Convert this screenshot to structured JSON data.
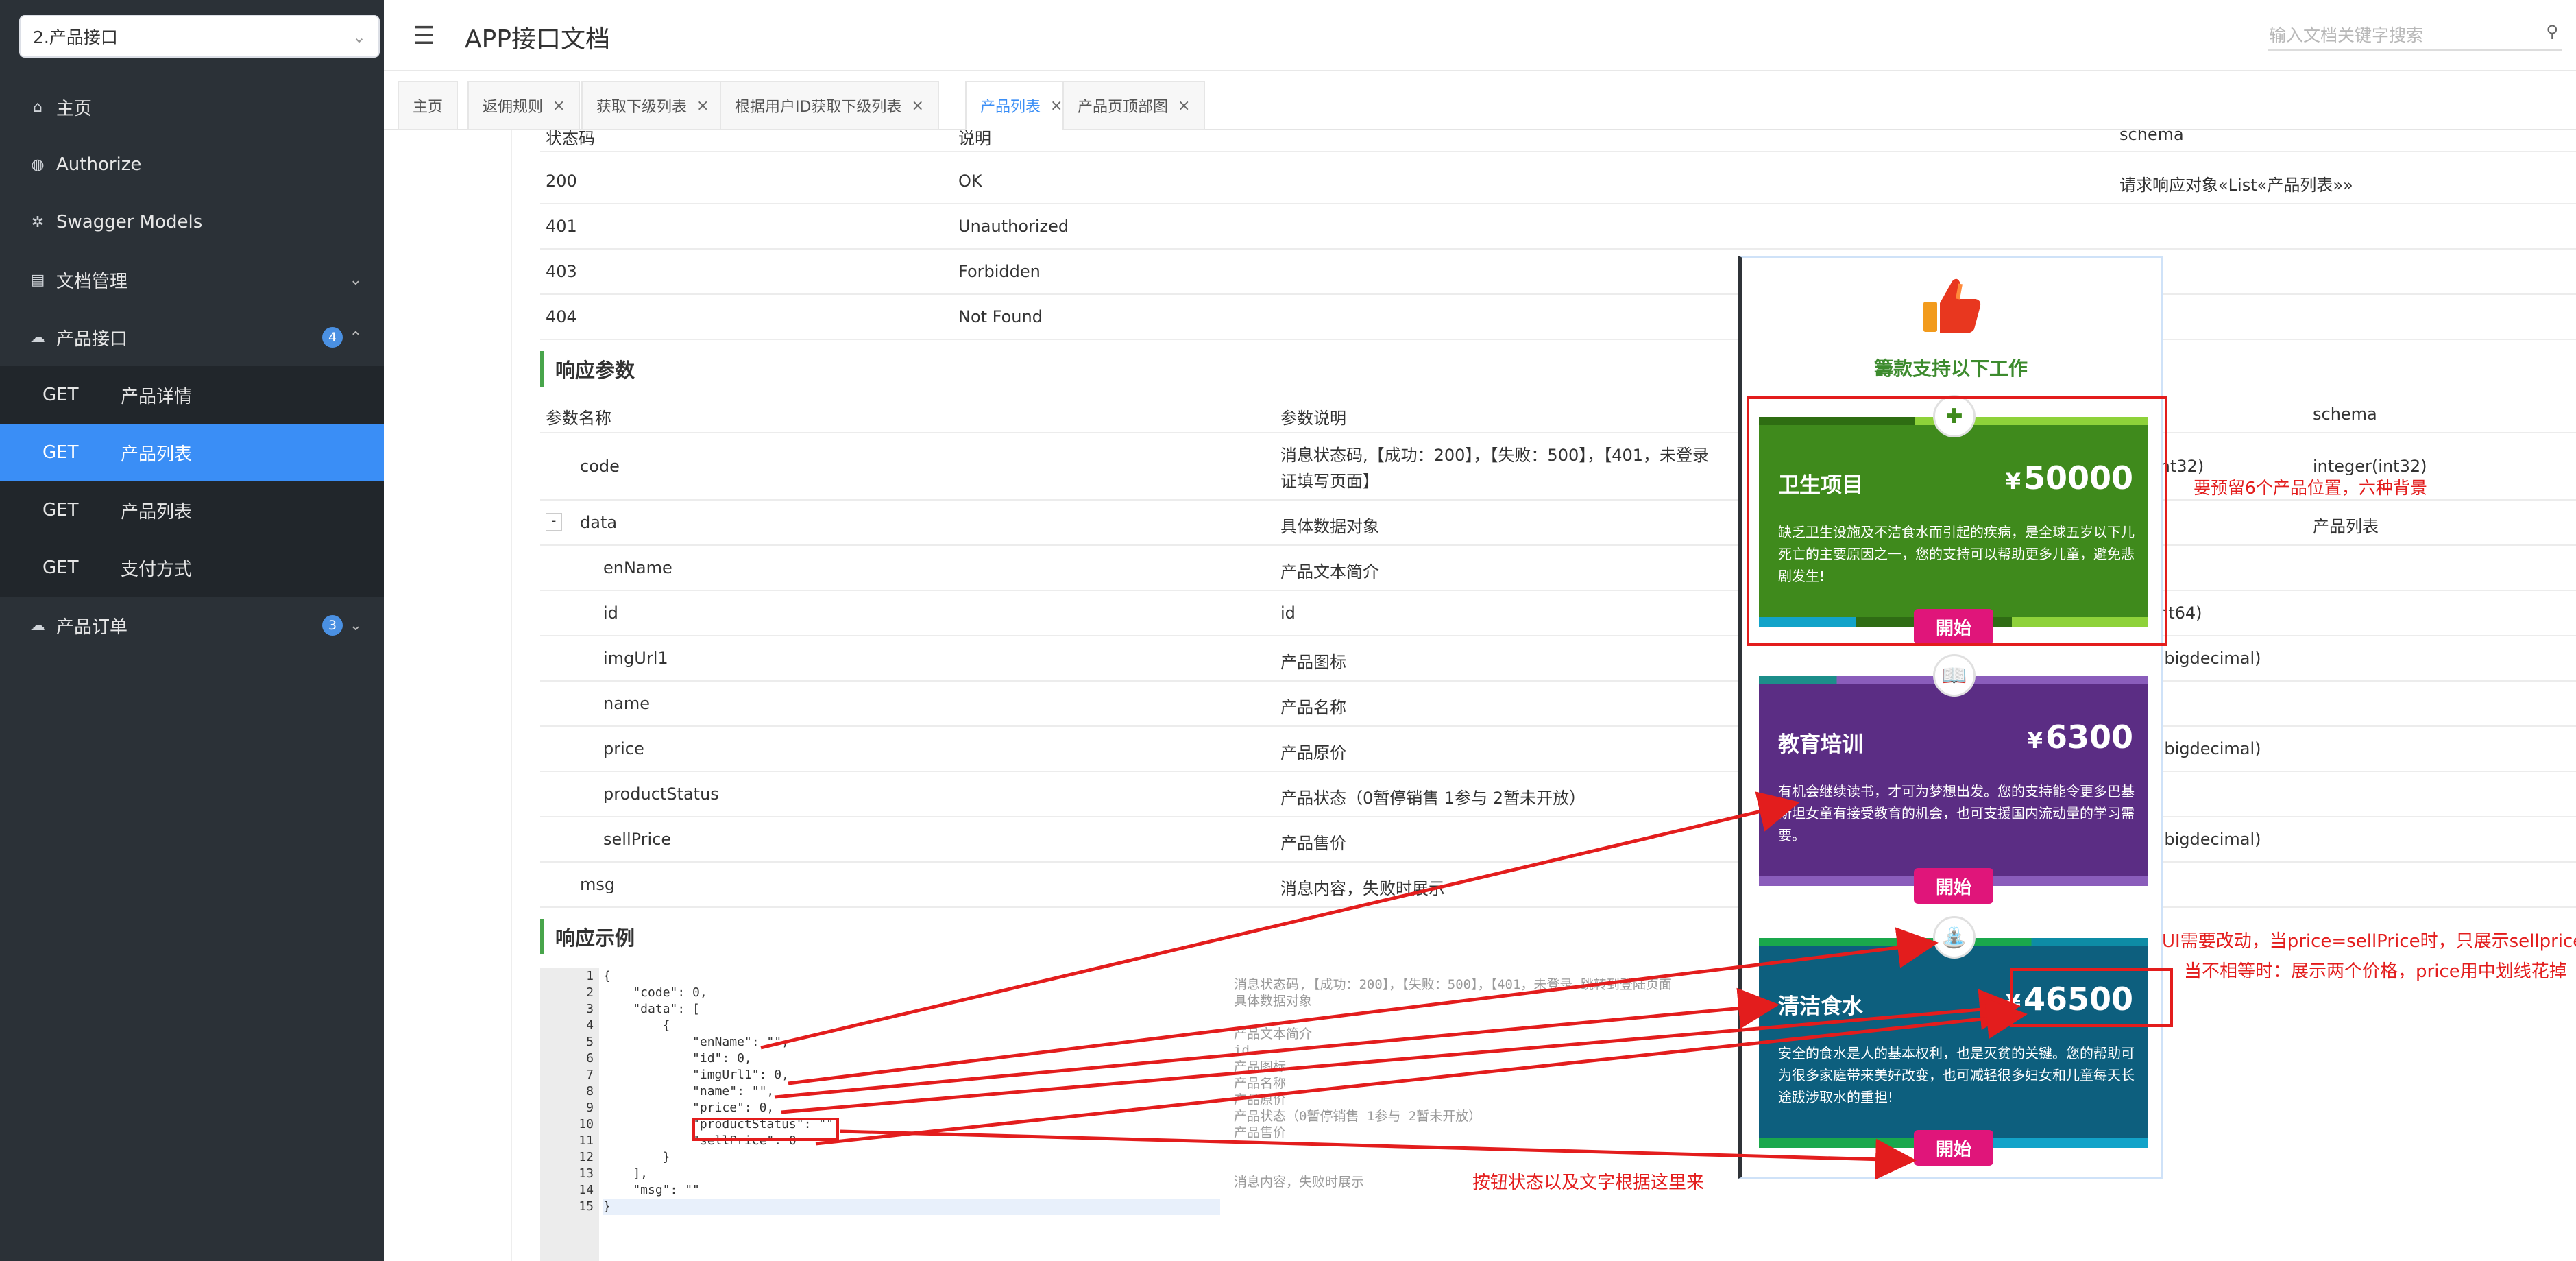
{
  "sidebar": {
    "selector_value": "2.产品接口",
    "items": [
      {
        "label": "主页",
        "icon": "home-icon"
      },
      {
        "label": "Authorize",
        "icon": "lock-icon"
      },
      {
        "label": "Swagger Models",
        "icon": "model-icon"
      },
      {
        "label": "文档管理",
        "icon": "doc-icon"
      },
      {
        "label": "产品接口",
        "icon": "cloud-icon",
        "badge": "4"
      },
      {
        "label": "产品订单",
        "icon": "cloud-icon",
        "badge": "3"
      }
    ],
    "sub_items": [
      {
        "method": "GET",
        "label": "产品详情"
      },
      {
        "method": "GET",
        "label": "产品列表"
      },
      {
        "method": "GET",
        "label": "产品列表"
      },
      {
        "method": "GET",
        "label": "支付方式"
      }
    ]
  },
  "header": {
    "title": "APP接口文档",
    "search_placeholder": "输入文档关键字搜索"
  },
  "tabs": [
    "主页",
    "返佣规则",
    "获取下级列表",
    "根据用户ID获取下级列表",
    "产品列表",
    "产品页顶部图"
  ],
  "status_table": {
    "headers": [
      "状态码",
      "说明",
      "schema"
    ],
    "rows": [
      [
        "200",
        "OK",
        "请求响应对象«List«产品列表»»"
      ],
      [
        "401",
        "Unauthorized",
        ""
      ],
      [
        "403",
        "Forbidden",
        ""
      ],
      [
        "404",
        "Not Found",
        ""
      ]
    ]
  },
  "response_params": {
    "title": "响应参数",
    "headers": [
      "参数名称",
      "参数说明",
      "schema"
    ],
    "rows": [
      {
        "name": "code",
        "desc": "消息状态码,【成功：200】，【失败：500】，【401，未登录",
        "desc2": "证填写页面】",
        "type": "int32)",
        "schema": "integer(int32)"
      },
      {
        "name": "data",
        "toggle": "-",
        "desc": "具体数据对象",
        "type": "",
        "schema": "产品列表"
      },
      {
        "name": "enName",
        "desc": "产品文本简介",
        "type": "",
        "schema": ""
      },
      {
        "name": "id",
        "desc": "id",
        "type": "nt64)",
        "schema": ""
      },
      {
        "name": "imgUrl1",
        "desc": "产品图标",
        "type": "(bigdecimal)",
        "schema": ""
      },
      {
        "name": "name",
        "desc": "产品名称",
        "type": "",
        "schema": ""
      },
      {
        "name": "price",
        "desc": "产品原价",
        "type": "(bigdecimal)",
        "schema": ""
      },
      {
        "name": "productStatus",
        "desc": "产品状态（0暂停销售 1参与 2暂未开放）",
        "type": "",
        "schema": ""
      },
      {
        "name": "sellPrice",
        "desc": "产品售价",
        "type": "(bigdecimal)",
        "schema": ""
      },
      {
        "name": "msg",
        "desc": "消息内容，失败时展示",
        "type": "",
        "schema": ""
      }
    ]
  },
  "response_example": {
    "title": "响应示例",
    "line_numbers": [
      "1",
      "2",
      "3",
      "4",
      "5",
      "6",
      "7",
      "8",
      "9",
      "10",
      "11",
      "12",
      "13",
      "14",
      "15"
    ],
    "code_lines": [
      "{",
      "    \"code\": 0,",
      "    \"data\": [",
      "        {",
      "            \"enName\": \"\",",
      "            \"id\": 0,",
      "            \"imgUrl1\": 0,",
      "            \"name\": \"\",",
      "            \"price\": 0,",
      "            \"productStatus\": \"\",",
      "            \"sellPrice\": 0",
      "        }",
      "    ],",
      "    \"msg\": \"\"",
      "}"
    ],
    "notes": [
      "消息状态码,【成功：200】，【失败：500】，【401，未登录-跳转到登陆页面",
      "具体数据对象",
      "",
      "产品文本简介",
      "id",
      "产品图标",
      "产品名称",
      "产品原价",
      "产品状态（0暂停销售 1参与 2暂未开放）",
      "产品售价",
      "",
      "",
      "消息内容，失败时展示"
    ]
  },
  "phone": {
    "donate_title": "籌款支持以下工作",
    "cards": [
      {
        "name": "卫生项目",
        "currency": "¥",
        "price": "50000",
        "icon": "medical-kit-icon",
        "desc": "缺乏卫生设施及不洁食水而引起的疾病，是全球五岁以下儿死亡的主要原因之一，您的支持可以帮助更多儿童，避免悲剧发生!",
        "button": "開始",
        "bg": "#3f8a1c"
      },
      {
        "name": "教育培训",
        "currency": "¥",
        "price": "6300",
        "icon": "book-icon",
        "desc": "有机会继续读书，才可为梦想出发。您的支持能令更多巴基斯坦女童有接受教育的机会，也可支援国内流动量的学习需要。",
        "button": "開始",
        "bg": "#5b2d84"
      },
      {
        "name": "清洁食水",
        "currency": "¥",
        "price": "46500",
        "icon": "water-tap-icon",
        "desc": "安全的食水是人的基本权利，也是灭贫的关键。您的帮助可为很多家庭带来美好改变，也可减轻很多妇女和儿童每天长途跋涉取水的重担!",
        "button": "開始",
        "bg": "#0d5f7e"
      }
    ]
  },
  "annotations": {
    "six_products": "要预留6个产品位置，六种背景",
    "price_line1": "UI需要改动，当price=sellPrice时，只展示sellprice",
    "price_line2": "当不相等时：展示两个价格，price用中划线花掉",
    "button_state": "按钮状态以及文字根据这里来"
  },
  "colors": {
    "sidebar_bg": "#2b3137",
    "active_blue": "#3a8ef6",
    "section_green": "#48a54b",
    "annotation_red": "#e31d1d"
  }
}
